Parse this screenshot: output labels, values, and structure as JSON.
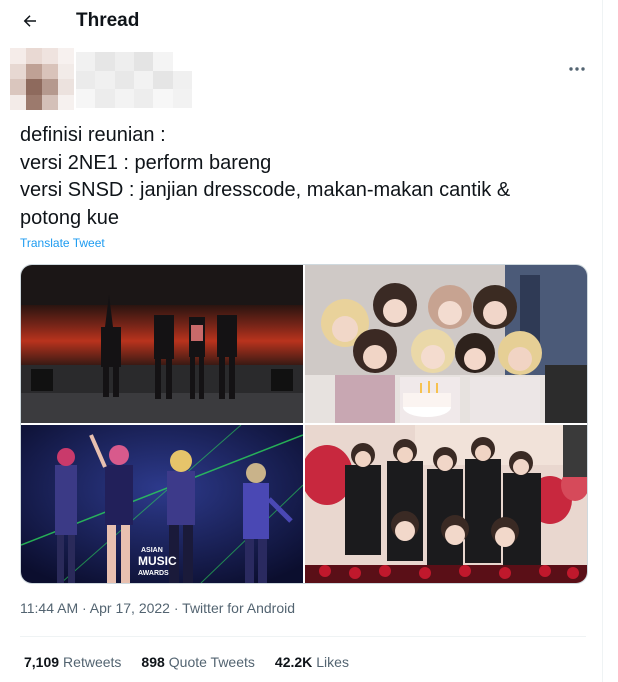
{
  "header": {
    "title": "Thread",
    "back_icon": "arrow-left-icon"
  },
  "author": {
    "avatar_state": "pixelated",
    "name_state": "pixelated",
    "more_icon": "more-horizontal-icon"
  },
  "tweet": {
    "lines": [
      "definisi reunian :",
      "versi 2NE1 : perform bareng",
      "versi SNSD : janjian dresscode, makan-makan cantik &",
      "potong kue"
    ],
    "translate_label": "Translate Tweet"
  },
  "media": {
    "photos": [
      {
        "name": "photo-2ne1-concert-stage"
      },
      {
        "name": "photo-snsd-group-cake"
      },
      {
        "name": "photo-2ne1-mama-awards",
        "caption_lines": [
          "ASIAN",
          "MUSIC",
          "AWARDS"
        ]
      },
      {
        "name": "photo-snsd-balloons-party"
      }
    ]
  },
  "meta": {
    "time": "11:44 AM",
    "separator": "·",
    "date": "Apr 17, 2022",
    "source": "Twitter for Android"
  },
  "stats": {
    "retweets_count": "7,109",
    "retweets_label": "Retweets",
    "quotes_count": "898",
    "quotes_label": "Quote Tweets",
    "likes_count": "42.2K",
    "likes_label": "Likes"
  },
  "colors": {
    "accent": "#1d9bf0",
    "text_primary": "#0f1419",
    "text_secondary": "#536471",
    "border": "#eff3f4"
  }
}
